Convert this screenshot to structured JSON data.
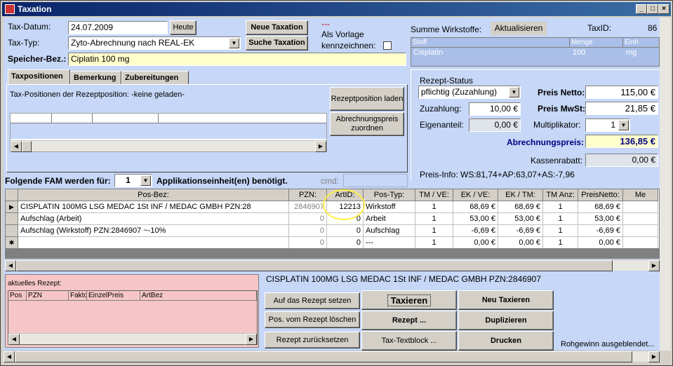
{
  "window": {
    "title": "Taxation"
  },
  "header": {
    "tax_datum_label": "Tax-Datum:",
    "tax_datum_value": "24.07.2009",
    "heute_label": "Heute",
    "tax_typ_label": "Tax-Typ:",
    "tax_typ_value": "Zyto-Abrechnung nach REAL-EK",
    "speicher_label": "Speicher-Bez.:",
    "speicher_value": "Ciplatin 100 mg",
    "neue_taxation": "Neue Taxation",
    "suche_taxation": "Suche Taxation",
    "dashes": "---",
    "als_vorlage": "Als Vorlage",
    "kennzeichnen": "kennzeichnen:",
    "summe_label": "Summe Wirkstoffe:",
    "aktualisieren": "Aktualisieren",
    "taxid_label": "TaxID:",
    "taxid_value": "86"
  },
  "wirkstoffe": {
    "headers": [
      "Stoff",
      "Menge",
      "Einh"
    ],
    "rows": [
      [
        "Cisplatin",
        "100",
        "mg"
      ]
    ]
  },
  "tabs": [
    {
      "label": "Taxpositionen"
    },
    {
      "label": "Bemerkung"
    },
    {
      "label": "Zubereitungen"
    }
  ],
  "taxpanel": {
    "info": "Tax-Positionen der Rezeptposition:  -keine geladen-",
    "btn_laden": "Rezeptposition laden",
    "btn_zuordnen": "Abrechnungspreis zuordnen"
  },
  "rezept": {
    "status_label": "Rezept-Status",
    "status_value": "pflichtig (Zuzahlung)",
    "zuzahlung_label": "Zuzahlung:",
    "zuzahlung_value": "10,00 €",
    "eigenanteil_label": "Eigenanteil:",
    "eigenanteil_value": "0,00 €",
    "preis_netto_label": "Preis Netto:",
    "preis_netto_value": "115,00 €",
    "preis_mwst_label": "Preis MwSt:",
    "preis_mwst_value": "21,85 €",
    "multiplikator_label": "Multiplikator:",
    "multiplikator_value": "1",
    "abrechnungspreis_label": "Abrechnungspreis:",
    "abrechnungspreis_value": "136,85 €",
    "kassenrabatt_label": "Kassenrabatt:",
    "kassenrabatt_value": "0,00 €",
    "preis_info": "Preis-Info: WS:81,74+AP:63,07+AS:-7,96"
  },
  "fam": {
    "label1": "Folgende FAM werden für:",
    "value": "1",
    "label2": "Applikationseinheit(en) benötigt.",
    "cmd_label": "cmd:"
  },
  "positions": {
    "headers": [
      "Pos-Bez:",
      "PZN:",
      "ArtID:",
      "Pos-Typ:",
      "TM / VE:",
      "EK / VE:",
      "EK / TM:",
      "TM Anz:",
      "PreisNetto:",
      "Me"
    ],
    "rows": [
      [
        "CISPLATIN 100MG LSG MEDAC   1St INF  / MEDAC GMBH PZN:28",
        "2846907",
        "12213",
        "Wirkstoff",
        "1",
        "68,69 €",
        "68,69 €",
        "1",
        "68,69 €",
        ""
      ],
      [
        "Aufschlag (Arbeit)",
        "0",
        "0",
        "Arbeit",
        "1",
        "53,00 €",
        "53,00 €",
        "1",
        "53,00 €",
        ""
      ],
      [
        "Aufschlag (Wirkstoff) PZN:2846907 ~-10%",
        "0",
        "0",
        "Aufschlag",
        "1",
        "-6,69 €",
        "-6,69 €",
        "1",
        "-6,69 €",
        ""
      ],
      [
        "",
        "0",
        "0",
        "---",
        "1",
        "0,00 €",
        "0,00 €",
        "1",
        "0,00 €",
        ""
      ]
    ]
  },
  "aktuell": {
    "title": "aktuelles Rezept:",
    "headers": [
      "Pos",
      "PZN",
      "Fakto",
      "EinzelPreis",
      "ArtBez"
    ]
  },
  "bottom": {
    "drug_line": "CISPLATIN 100MG LSG MEDAC   1St INF  / MEDAC GMBH PZN:2846907",
    "btn_auf": "Auf das Rezept setzen",
    "btn_loeschen": "Pos. vom Rezept löschen",
    "btn_zurueck": "Rezept zurücksetzen",
    "btn_taxieren": "Taxieren",
    "btn_rezept": "Rezept ...",
    "btn_textblock": "Tax-Textblock ...",
    "btn_neu_taxieren": "Neu Taxieren",
    "btn_duplizieren": "Duplizieren",
    "btn_drucken": "Drucken",
    "rohgewinn": "Rohgewinn ausgeblendet..."
  },
  "colors": {
    "client_bg": "#c6d7f7",
    "pink_panel": "#f6c6c6",
    "yellow_field": "#ffffcc",
    "title_start": "#0a246a"
  }
}
